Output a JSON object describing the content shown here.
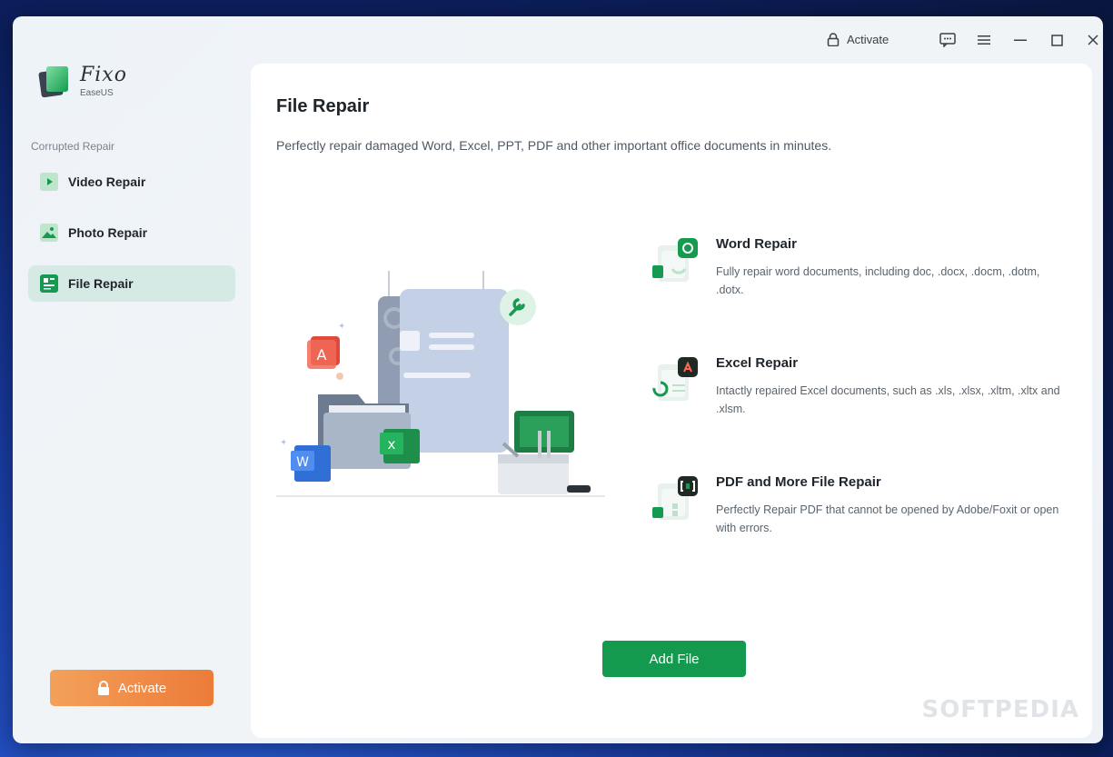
{
  "app": {
    "name": "Fixo",
    "vendor": "EaseUS"
  },
  "titlebar": {
    "activate_label": "Activate",
    "icons": [
      "lock-icon",
      "feedback-icon",
      "menu-icon",
      "minimize-icon",
      "maximize-icon",
      "close-icon"
    ]
  },
  "sidebar": {
    "caption": "Corrupted Repair",
    "items": [
      {
        "label": "Video Repair",
        "icon": "video-icon",
        "active": false
      },
      {
        "label": "Photo Repair",
        "icon": "photo-icon",
        "active": false
      },
      {
        "label": "File Repair",
        "icon": "file-icon",
        "active": true
      }
    ],
    "activate_label": "Activate"
  },
  "main": {
    "title": "File Repair",
    "description": "Perfectly repair damaged Word, Excel, PPT, PDF and other important office documents in minutes.",
    "features": [
      {
        "title": "Word Repair",
        "description": "Fully repair word documents, including doc, .docx, .docm, .dotm, .dotx.",
        "icon": "word-repair-icon"
      },
      {
        "title": "Excel Repair",
        "description": "Intactly repaired Excel documents, such as .xls, .xlsx, .xltm, .xltx and .xlsm.",
        "icon": "excel-repair-icon"
      },
      {
        "title": "PDF and More File Repair",
        "description": "Perfectly Repair PDF that cannot be opened by Adobe/Foxit or open with errors.",
        "icon": "pdf-repair-icon"
      }
    ],
    "add_file_label": "Add File"
  },
  "watermark": "SOFTPEDIA",
  "colors": {
    "accent": "#149a4f",
    "activate": "#ee8a44",
    "active_nav": "#d5e9e5"
  }
}
